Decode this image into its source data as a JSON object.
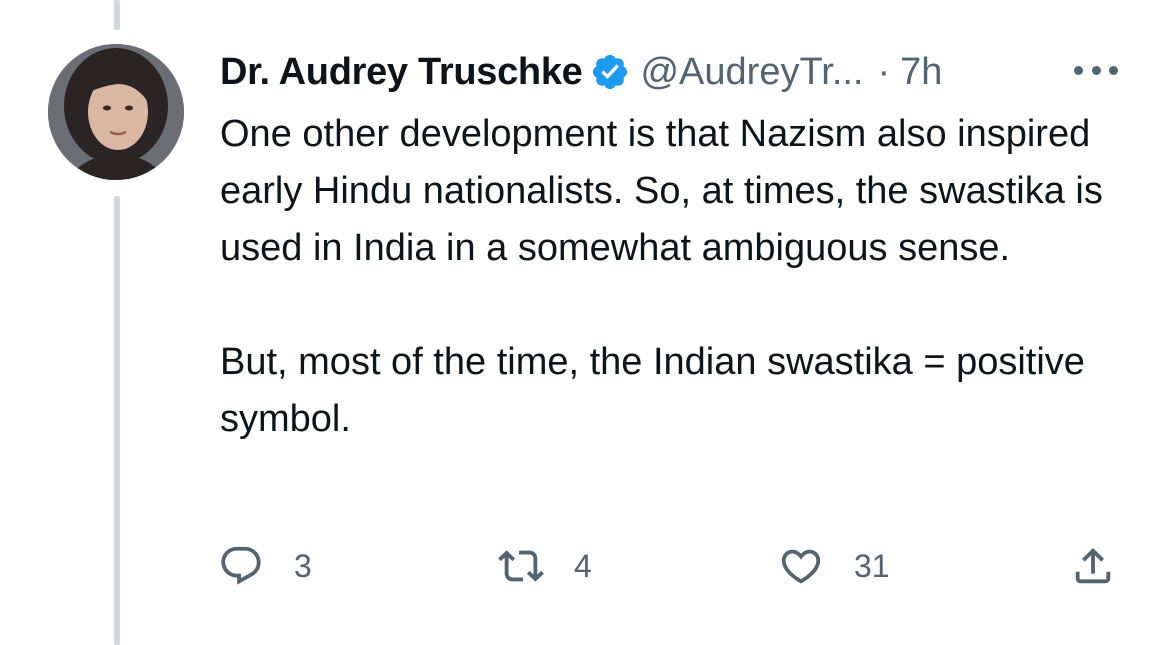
{
  "tweet": {
    "author": {
      "display_name": "Dr. Audrey Truschke",
      "handle": "@AudreyTr...",
      "verified": true,
      "avatar": "profile-photo"
    },
    "separator": "·",
    "time": "7h",
    "paragraphs": [
      "One other development is that Nazism also inspired early Hindu nationalists. So, at times, the swastika is used in India in a somewhat ambiguous sense.",
      "But, most of the time, the Indian swastika = positive symbol."
    ],
    "counts": {
      "replies": "3",
      "retweets": "4",
      "likes": "31"
    }
  },
  "icons": {
    "verified": "verified-badge-icon",
    "more": "more-options-icon",
    "reply": "reply-icon",
    "retweet": "retweet-icon",
    "like": "heart-icon",
    "share": "share-icon"
  },
  "colors": {
    "verified": "#1d9bf0",
    "secondary_text": "#536471",
    "primary_text": "#0f1419",
    "thread_line": "#cfd9de"
  }
}
